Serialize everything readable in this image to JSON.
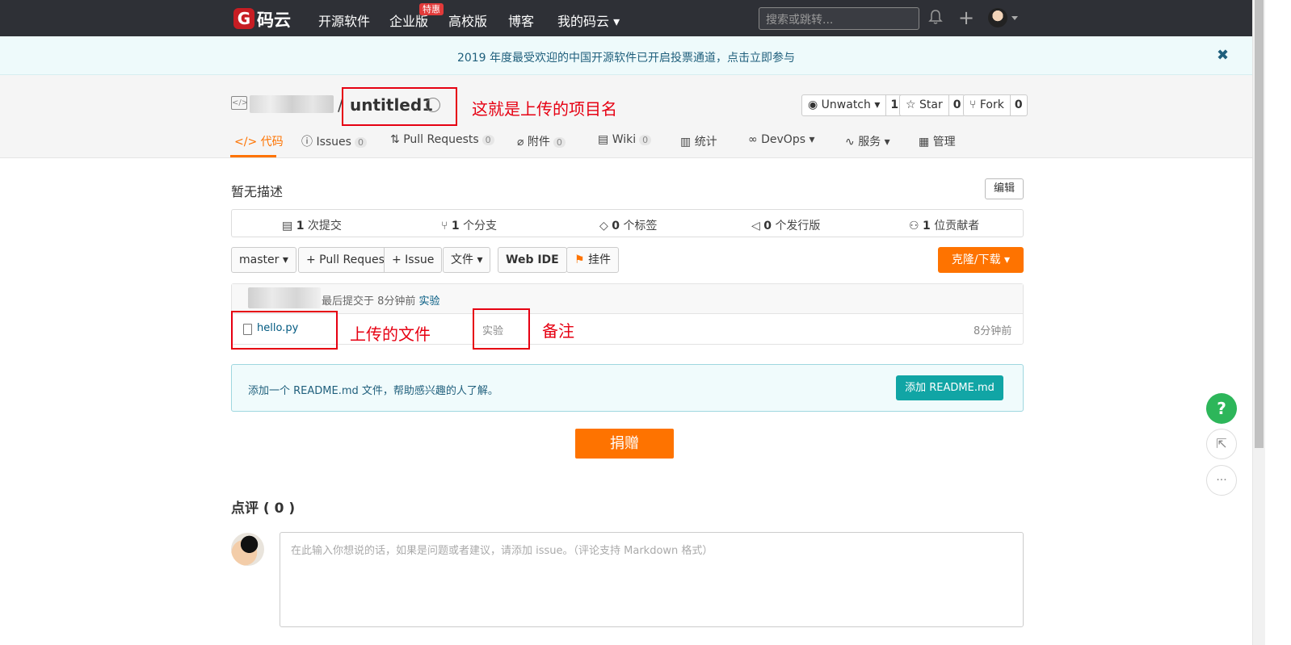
{
  "topnav": {
    "logo_mark": "G",
    "logo_text": "码云",
    "links": [
      "开源软件",
      "企业版",
      "高校版",
      "博客",
      "我的码云"
    ],
    "hot_badge": "特惠",
    "search_placeholder": "搜索或跳转...",
    "plus": "+"
  },
  "banner": {
    "text": "2019 年度最受欢迎的中国开源软件已开启投票通道，点击立即参与",
    "close": "✖"
  },
  "repo": {
    "slash": "/",
    "name": "untitled1",
    "watch": {
      "label": "Unwatch",
      "count": "1"
    },
    "star": {
      "label": "Star",
      "count": "0"
    },
    "fork": {
      "label": "Fork",
      "count": "0"
    }
  },
  "tabs": [
    {
      "label": "代码"
    },
    {
      "label": "Issues",
      "count": "0"
    },
    {
      "label": "Pull Requests",
      "count": "0"
    },
    {
      "label": "附件",
      "count": "0"
    },
    {
      "label": "Wiki",
      "count": "0"
    },
    {
      "label": "统计"
    },
    {
      "label": "DevOps"
    },
    {
      "label": "服务"
    },
    {
      "label": "管理"
    }
  ],
  "description": {
    "text": "暂无描述",
    "edit": "编辑"
  },
  "stats": [
    {
      "num": "1",
      "label": "次提交"
    },
    {
      "num": "1",
      "label": "个分支"
    },
    {
      "num": "0",
      "label": "个标签"
    },
    {
      "num": "0",
      "label": "个发行版"
    },
    {
      "num": "1",
      "label": "位贡献者"
    }
  ],
  "toolbar": {
    "branch": "master",
    "pull_request": "+ Pull Request",
    "issue": "+ Issue",
    "file": "文件",
    "web_ide": "Web IDE",
    "widget": "挂件",
    "clone": "克隆/下载"
  },
  "commit": {
    "text": "最后提交于 8分钟前",
    "message": "实验"
  },
  "files": [
    {
      "name": "hello.py",
      "message": "实验",
      "time": "8分钟前"
    }
  ],
  "readme": {
    "text": "添加一个 README.md 文件，帮助感兴趣的人了解。",
    "button": "添加 README.md"
  },
  "donate": "捐赠",
  "reviews": {
    "title": "点评 ( 0 )",
    "placeholder": "在此输入你想说的话，如果是问题或者建议，请添加 issue。（评论支持 Markdown 格式）"
  },
  "annotations": {
    "project_name": "这就是上传的项目名",
    "uploaded_file": "上传的文件",
    "note": "备注"
  },
  "fabs": {
    "help": "?"
  }
}
